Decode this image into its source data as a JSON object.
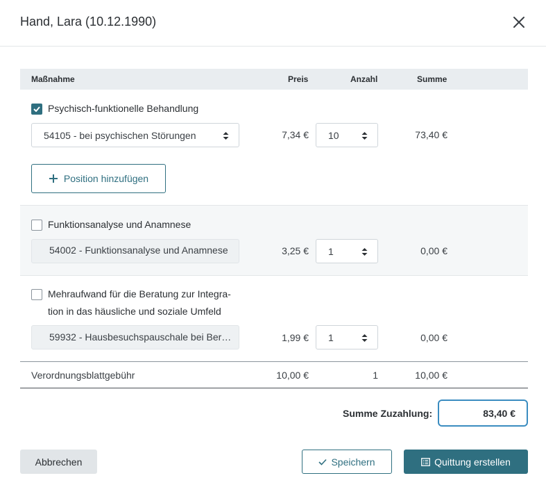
{
  "dialog": {
    "title": "Hand, Lara (10.12.1990)"
  },
  "table": {
    "headers": {
      "measure": "Maßnahme",
      "price": "Preis",
      "count": "Anzahl",
      "sum": "Summe"
    }
  },
  "items": [
    {
      "label": "Psychisch-funktionelle Behandlung",
      "checked": true,
      "position": "54105 - bei psychischen Störungen",
      "price": "7,34 €",
      "count": "10",
      "sum": "73,40 €",
      "add_label": "Position hinzufügen"
    },
    {
      "label": "Funktionsanalyse und Anamnese",
      "checked": false,
      "position": "54002 - Funktionsanalyse und Anamnese",
      "price": "3,25 €",
      "count": "1",
      "sum": "0,00 €"
    },
    {
      "label_line1": "Mehraufwand für die Beratung zur Integra-",
      "label_line2": "tion in das häusliche und soziale Umfeld",
      "checked": false,
      "position": "59932 - Hausbesuchspauschale bei Berat…",
      "price": "1,99 €",
      "count": "1",
      "sum": "0,00 €"
    }
  ],
  "fee": {
    "label": "Verordnungsblattgebühr",
    "price": "10,00 €",
    "count": "1",
    "sum": "10,00 €"
  },
  "total": {
    "label": "Summe Zuzahlung:",
    "value": "83,40 €"
  },
  "buttons": {
    "cancel": "Abbrechen",
    "save": "Speichern",
    "receipt": "Quittung erstellen"
  },
  "colors": {
    "accent": "#2f6f80",
    "focus": "#3a8cc0"
  },
  "icons": {
    "close": "close-icon",
    "check": "check-icon",
    "plus": "plus-icon",
    "sort": "sort-arrows-icon",
    "receipt": "receipt-icon"
  }
}
